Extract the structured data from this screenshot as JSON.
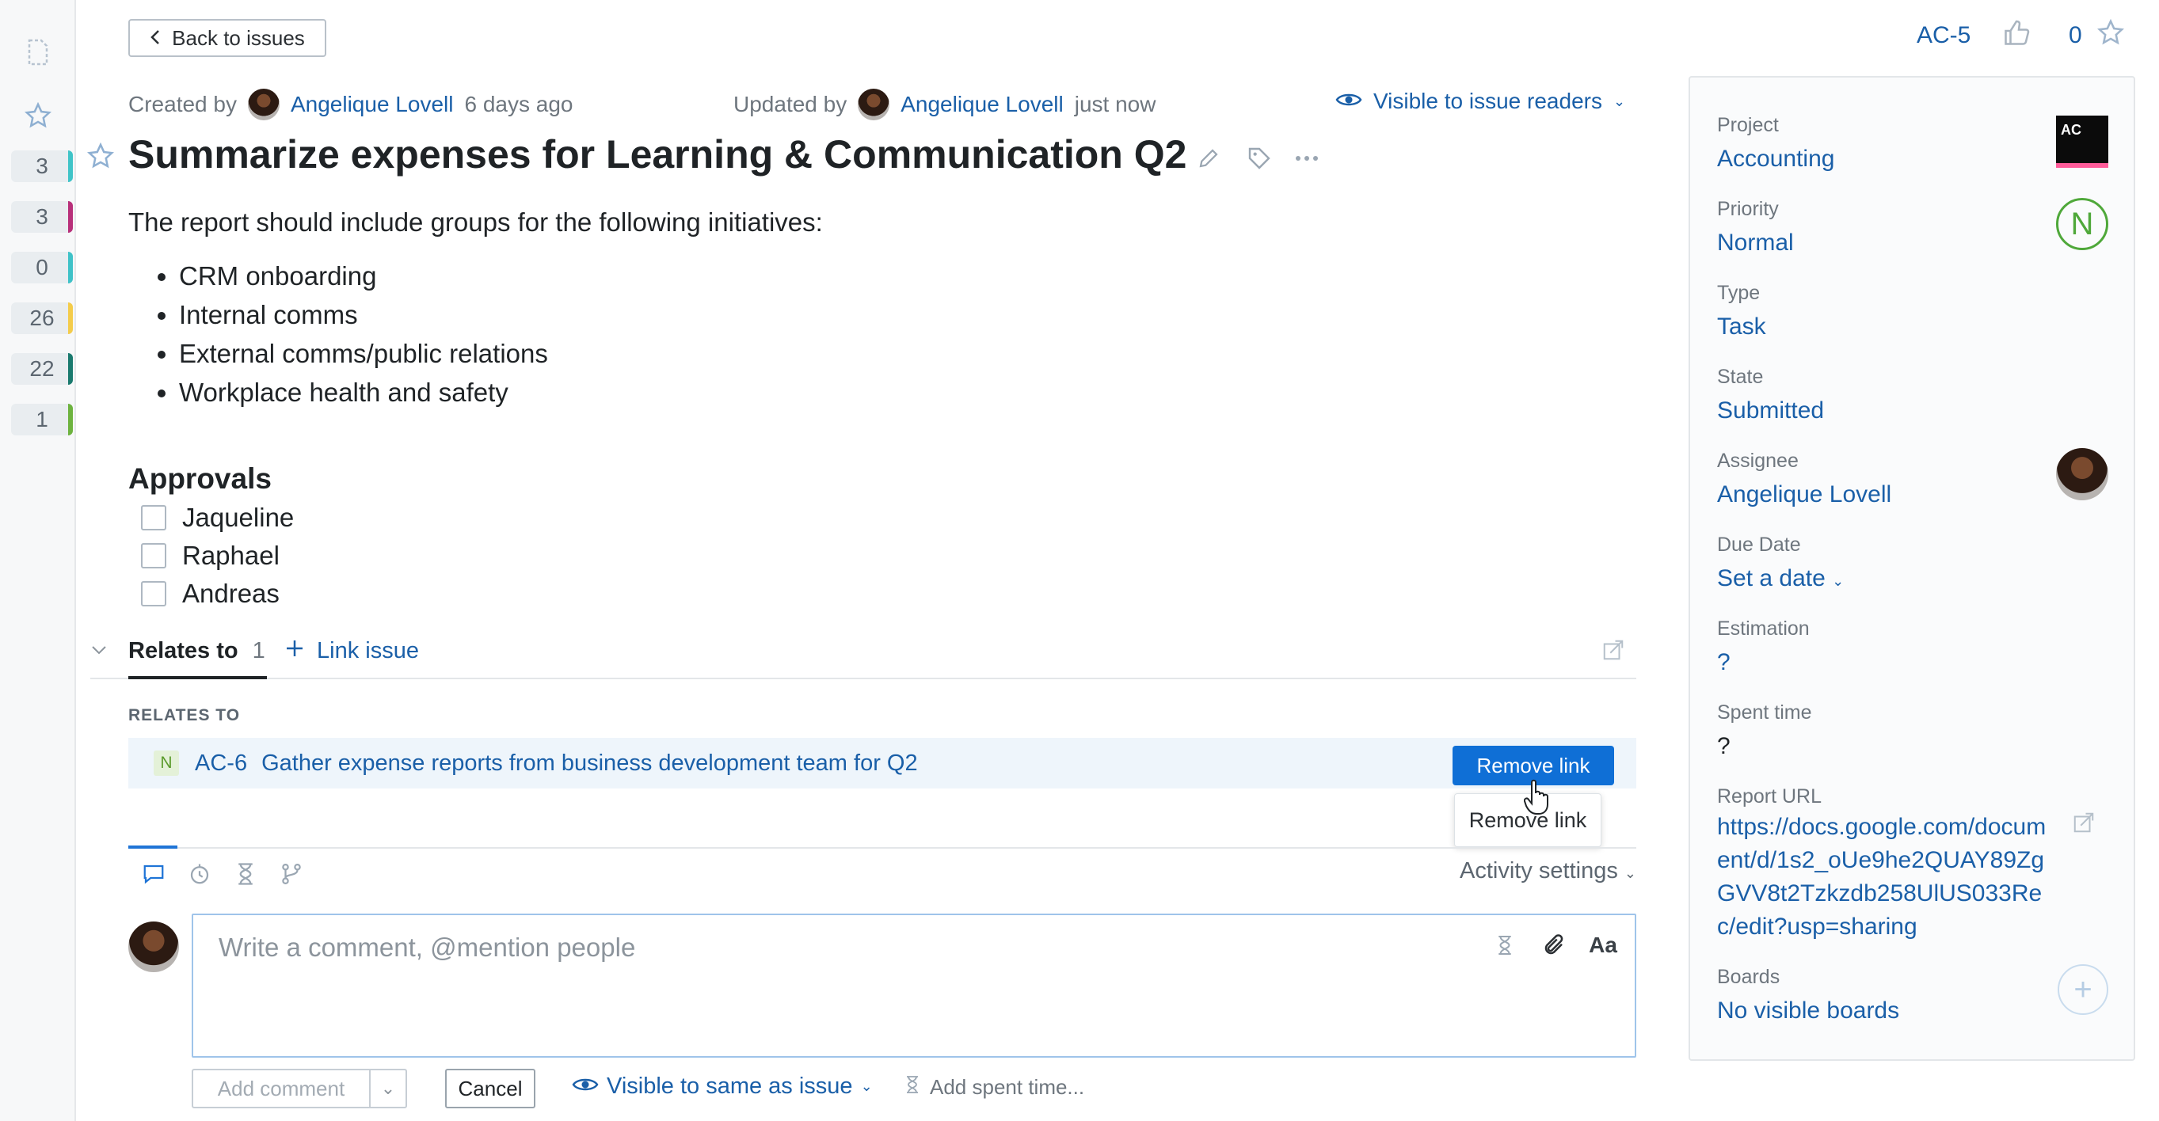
{
  "nav": {
    "back_label": "Back to issues"
  },
  "left_rail": {
    "counters": [
      {
        "value": "3",
        "color": "#40c4c8"
      },
      {
        "value": "3",
        "color": "#b8307a"
      },
      {
        "value": "0",
        "color": "#3fc2c8"
      },
      {
        "value": "26",
        "color": "#f4cc4b"
      },
      {
        "value": "22",
        "color": "#1a7a6e"
      },
      {
        "value": "1",
        "color": "#6db33f"
      }
    ]
  },
  "issue": {
    "id": "AC-5",
    "votes": "0",
    "created_label": "Created by",
    "created_by": "Angelique Lovell",
    "created_when": "6 days ago",
    "updated_label": "Updated by",
    "updated_by": "Angelique Lovell",
    "updated_when": "just now",
    "visibility": "Visible to issue readers",
    "title": "Summarize expenses for Learning & Communication Q2",
    "description_intro": "The report should include groups for the following initiatives:",
    "initiatives": [
      "CRM onboarding",
      "Internal comms",
      "External comms/public relations",
      "Workplace health and safety"
    ],
    "approvals_heading": "Approvals",
    "approvals": [
      "Jaqueline",
      "Raphael",
      "Andreas"
    ]
  },
  "links": {
    "tab_label": "Relates to",
    "tab_count": "1",
    "link_issue_label": "Link issue",
    "section_label": "RELATES TO",
    "items": [
      {
        "priority": "N",
        "id": "AC-6",
        "summary": "Gather expense reports from business development team for Q2"
      }
    ],
    "remove_button": "Remove link",
    "tooltip": "Remove link"
  },
  "activity": {
    "settings_label": "Activity settings",
    "comment_placeholder": "Write a comment, @mention people",
    "format_label": "Aa",
    "add_comment": "Add comment",
    "cancel": "Cancel",
    "visibility": "Visible to same as issue",
    "add_spent_time": "Add spent time..."
  },
  "fields": {
    "project_label": "Project",
    "project": "Accounting",
    "project_logo": "AC",
    "priority_label": "Priority",
    "priority": "Normal",
    "priority_letter": "N",
    "type_label": "Type",
    "type": "Task",
    "state_label": "State",
    "state": "Submitted",
    "assignee_label": "Assignee",
    "assignee": "Angelique Lovell",
    "due_label": "Due Date",
    "due": "Set a date",
    "estimation_label": "Estimation",
    "estimation": "?",
    "spent_label": "Spent time",
    "spent": "?",
    "report_url_label": "Report URL",
    "report_url": "https://docs.google.com/document/d/1s2_oUe9he2QUAY89ZgGVV8t2Tzkzdb258UlUS033Rec/edit?usp=sharing",
    "boards_label": "Boards",
    "boards": "No visible boards"
  },
  "colors": {
    "accent": "#1a5fa8",
    "primary_button": "#0f6fd6",
    "priority_normal": "#4fa83a"
  }
}
